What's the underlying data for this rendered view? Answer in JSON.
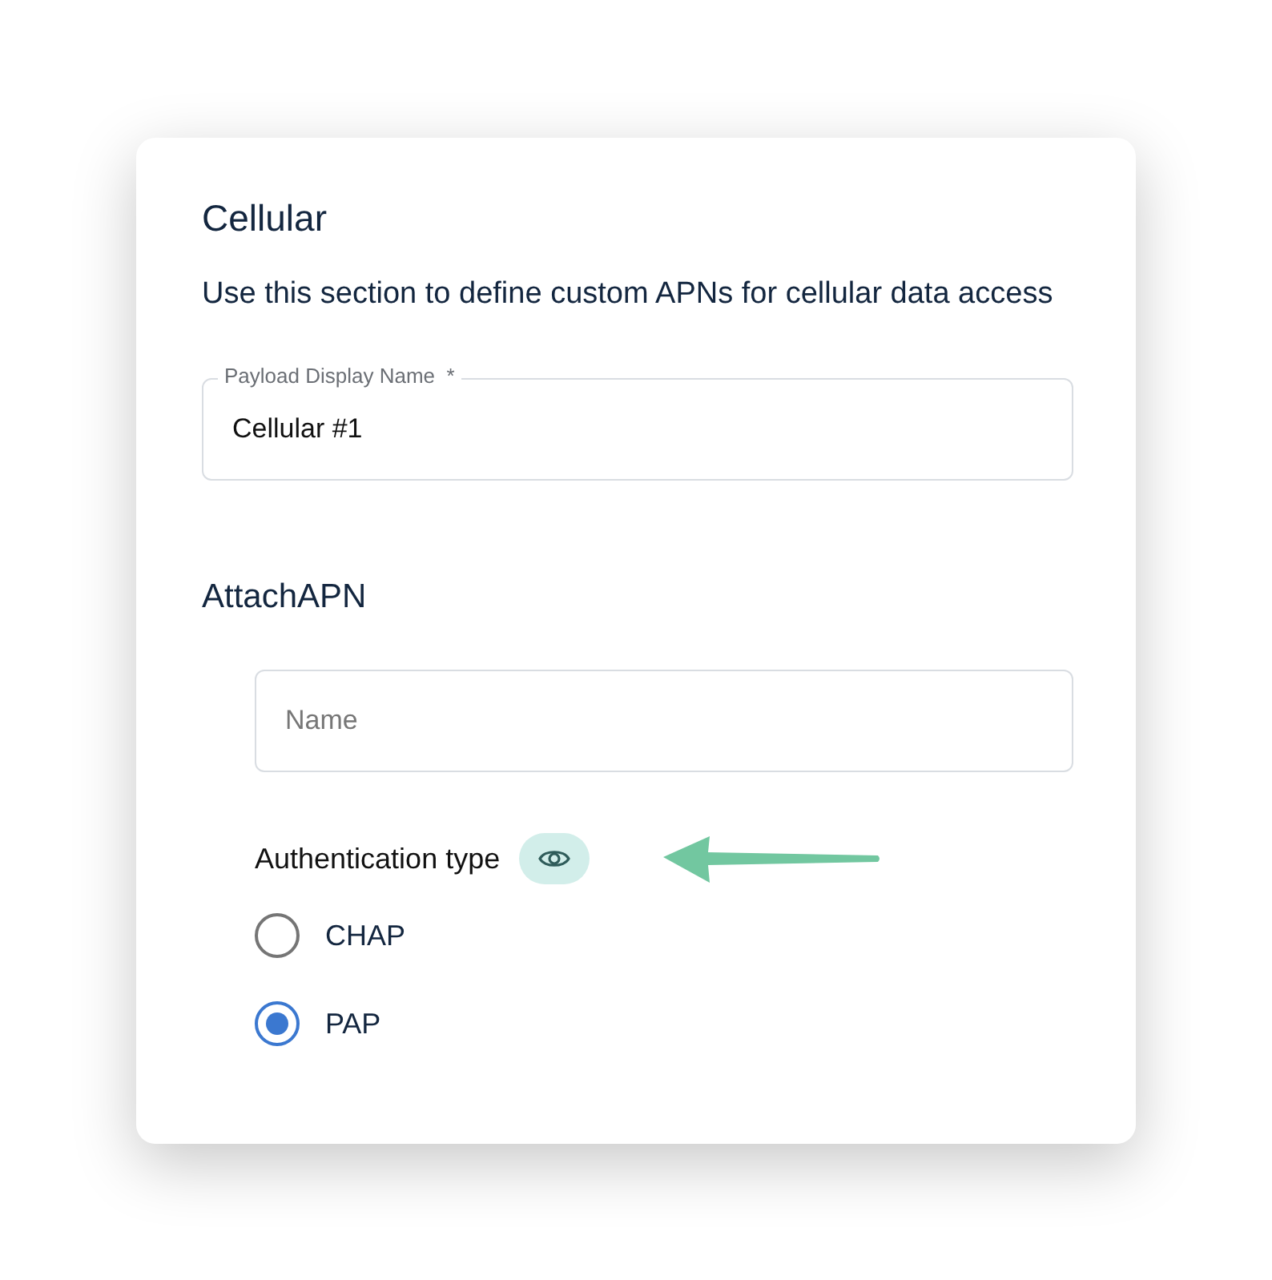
{
  "title": "Cellular",
  "description": "Use this section to define custom APNs for cellular data access",
  "display_name_field": {
    "label": "Payload Display Name  *",
    "value": "Cellular #1"
  },
  "section": {
    "title": "AttachAPN",
    "name_field": {
      "placeholder": "Name"
    },
    "auth_label": "Authentication type",
    "options": [
      {
        "label": "CHAP",
        "selected": false
      },
      {
        "label": "PAP",
        "selected": true
      }
    ]
  }
}
